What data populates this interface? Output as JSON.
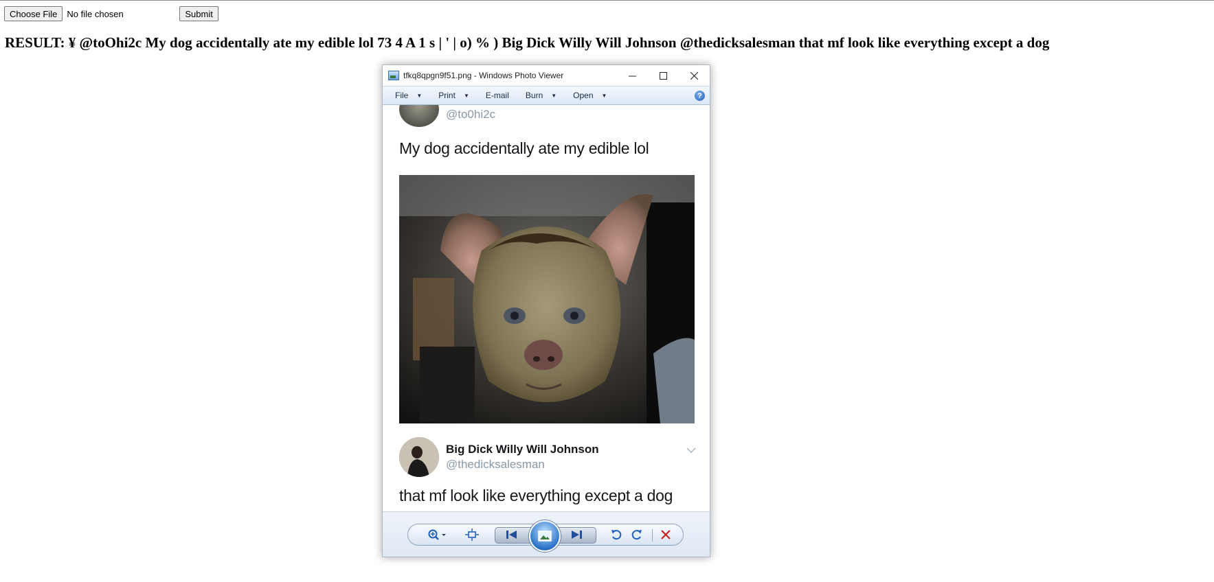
{
  "form": {
    "choose_file_label": "Choose File",
    "file_status": "No file chosen",
    "submit_label": "Submit"
  },
  "result_text": "RESULT: ¥ @toOhi2c My dog accidentally ate my edible lol 73 4 A 1 s | ' | o) % ) Big Dick Willy Will Johnson @thedicksalesman that mf look like everything except a dog",
  "viewer": {
    "title": "tfkq8qpgn9f51.png - Windows Photo Viewer",
    "menu": [
      {
        "label": "File",
        "has_dropdown": true
      },
      {
        "label": "Print",
        "has_dropdown": true
      },
      {
        "label": "E-mail",
        "has_dropdown": false
      },
      {
        "label": "Burn",
        "has_dropdown": true
      },
      {
        "label": "Open",
        "has_dropdown": true
      }
    ],
    "help_glyph": "?",
    "toolbar_icons": [
      "zoom-icon",
      "actual-size-icon",
      "previous-icon",
      "slideshow-icon",
      "next-icon",
      "rotate-counterclockwise-icon",
      "rotate-clockwise-icon",
      "delete-icon"
    ]
  },
  "tweet": {
    "author_handle": "@to0hi2c",
    "text": "My dog accidentally ate my edible lol",
    "reply_name": "Big Dick Willy Will Johnson",
    "reply_handle": "@thedicksalesman",
    "reply_text": "that mf look like everything except a dog"
  },
  "colors": {
    "menubar_text": "#1b2b45",
    "tweet_text": "#14171a",
    "handle_text": "#8899a6",
    "delete_red": "#c8201e",
    "accent_blue": "#2b73c9"
  }
}
